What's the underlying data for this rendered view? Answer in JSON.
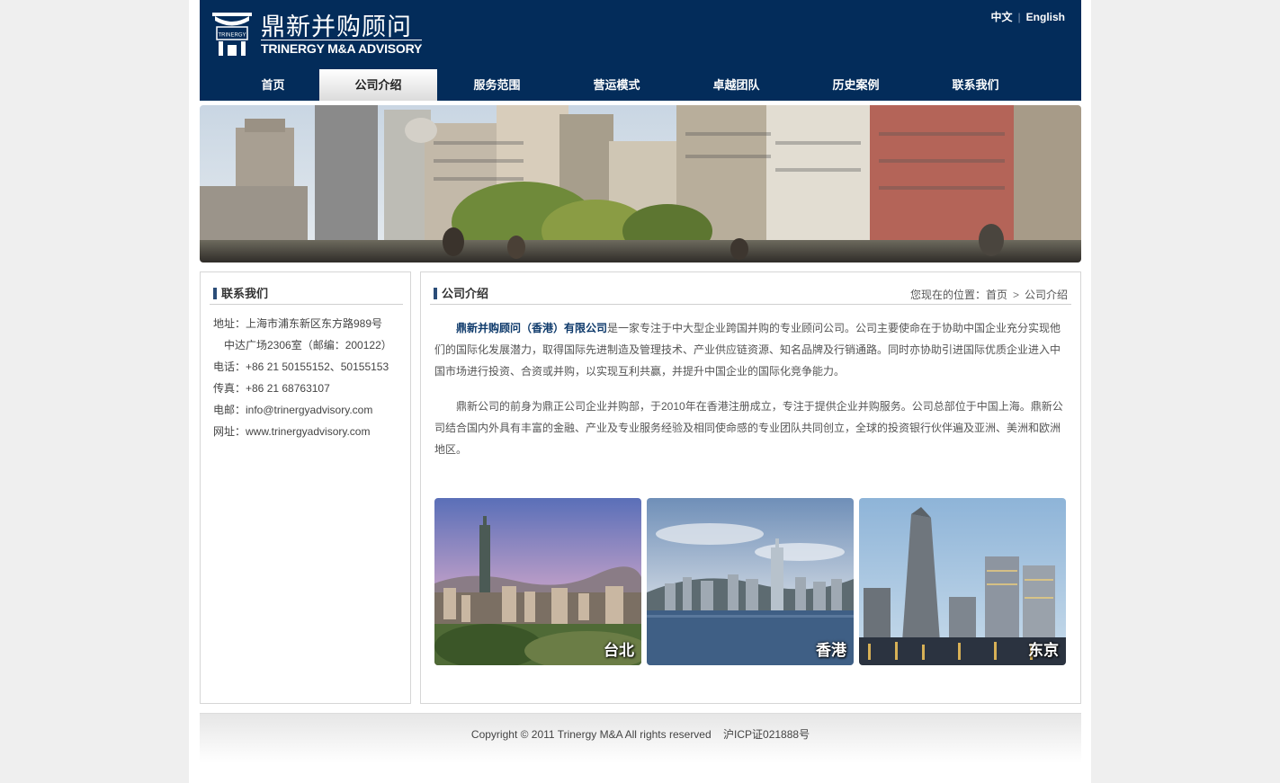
{
  "header": {
    "logo_cn": "鼎新并购顾问",
    "logo_en": "TRINERGY M&A ADVISORY",
    "logo_mark_text": "TRINERGY",
    "lang": {
      "zh": "中文",
      "sep": "|",
      "en": "English"
    }
  },
  "nav": [
    {
      "label": "首页",
      "active": false
    },
    {
      "label": "公司介绍",
      "active": true
    },
    {
      "label": "服务范围",
      "active": false
    },
    {
      "label": "营运模式",
      "active": false
    },
    {
      "label": "卓越团队",
      "active": false
    },
    {
      "label": "历史案例",
      "active": false
    },
    {
      "label": "联系我们",
      "active": false
    }
  ],
  "sidebar": {
    "title": "联系我们",
    "lines": [
      "地址：上海市浦东新区东方路989号",
      "中达广场2306室（邮编：200122）",
      "电话：+86 21 50155152、50155153",
      "传真：+86 21 68763107",
      "电邮：info@trinergyadvisory.com",
      "网址：www.trinergyadvisory.com"
    ]
  },
  "main": {
    "title": "公司介绍",
    "breadcrumb": {
      "prefix": "您现在的位置：",
      "home": "首页",
      "sep": ">",
      "current": "公司介绍"
    },
    "para1_strong": "鼎新并购顾问（香港）有限公司",
    "para1_rest": "是一家专注于中大型企业跨国并购的专业顾问公司。公司主要使命在于协助中国企业充分实现他们的国际化发展潜力，取得国际先进制造及管理技术、产业供应链资源、知名品牌及行销通路。同时亦协助引进国际优质企业进入中国市场进行投资、合资或并购，以实现互利共赢，并提升中国企业的国际化竞争能力。",
    "para2": "鼎新公司的前身为鼎正公司企业并购部，于2010年在香港注册成立，专注于提供企业并购服务。公司总部位于中国上海。鼎新公司结合国内外具有丰富的金融、产业及专业服务经验及相同使命感的专业团队共同创立，全球的投资银行伙伴遍及亚洲、美洲和欧洲地区。",
    "cities": [
      "台北",
      "香港",
      "东京"
    ]
  },
  "footer": {
    "copyright": "Copyright © 2011 Trinergy M&A All rights reserved",
    "icp": "沪ICP证021888号"
  },
  "colors": {
    "header_bg": "#032c5a",
    "accent": "#0e3a6b"
  }
}
